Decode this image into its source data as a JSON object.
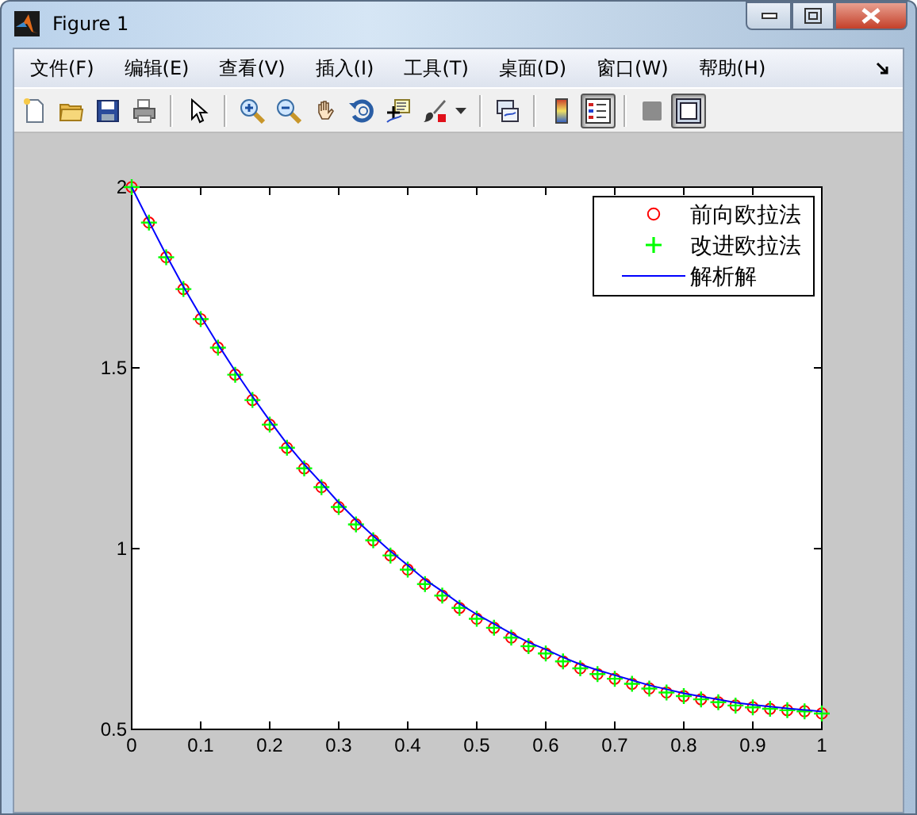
{
  "window": {
    "title": "Figure 1"
  },
  "menu": [
    {
      "label": "文件(F)"
    },
    {
      "label": "编辑(E)"
    },
    {
      "label": "查看(V)"
    },
    {
      "label": "插入(I)"
    },
    {
      "label": "工具(T)"
    },
    {
      "label": "桌面(D)"
    },
    {
      "label": "窗口(W)"
    },
    {
      "label": "帮助(H)"
    }
  ],
  "toolbar": [
    {
      "kind": "new",
      "pressed": false
    },
    {
      "kind": "open",
      "pressed": false
    },
    {
      "kind": "save",
      "pressed": false
    },
    {
      "kind": "print",
      "pressed": false
    },
    {
      "kind": "sep"
    },
    {
      "kind": "pointer",
      "pressed": false
    },
    {
      "kind": "sep"
    },
    {
      "kind": "zoom-in",
      "pressed": false
    },
    {
      "kind": "zoom-out",
      "pressed": false
    },
    {
      "kind": "pan",
      "pressed": false
    },
    {
      "kind": "rotate",
      "pressed": false
    },
    {
      "kind": "data-cursor",
      "pressed": false
    },
    {
      "kind": "brush",
      "pressed": false
    },
    {
      "kind": "caret"
    },
    {
      "kind": "sep"
    },
    {
      "kind": "link",
      "pressed": false
    },
    {
      "kind": "sep"
    },
    {
      "kind": "colorbar",
      "pressed": false
    },
    {
      "kind": "legend",
      "pressed": true
    },
    {
      "kind": "sep"
    },
    {
      "kind": "hide-tools",
      "pressed": false
    },
    {
      "kind": "show-tools",
      "pressed": true
    }
  ],
  "chart_data": {
    "type": "scatter",
    "legend": true,
    "xlim": [
      0,
      1
    ],
    "ylim": [
      0.5,
      2
    ],
    "xticks": [
      0,
      {
        "value": 0.1,
        "label": "0.1"
      },
      {
        "value": 0.2,
        "label": "0.2"
      },
      {
        "value": 0.3,
        "label": "0.3"
      },
      {
        "value": 0.4,
        "label": "0.4"
      },
      {
        "value": 0.5,
        "label": "0.5"
      },
      {
        "value": 0.6,
        "label": "0.6"
      },
      {
        "value": 0.7,
        "label": "0.7"
      },
      {
        "value": 0.8,
        "label": "0.8"
      },
      {
        "value": 0.9,
        "label": "0.9"
      },
      1
    ],
    "yticks": [
      {
        "value": 0.5,
        "label": "0.5"
      },
      1,
      {
        "value": 1.5,
        "label": "1.5"
      },
      2
    ],
    "x": [
      0,
      0.025,
      0.05,
      0.075,
      0.1,
      0.125,
      0.15,
      0.175,
      0.2,
      0.225,
      0.25,
      0.275,
      0.3,
      0.325,
      0.35,
      0.375,
      0.4,
      0.425,
      0.45,
      0.475,
      0.5,
      0.525,
      0.55,
      0.575,
      0.6,
      0.625,
      0.65,
      0.675,
      0.7,
      0.725,
      0.75,
      0.775,
      0.8,
      0.825,
      0.85,
      0.875,
      0.9,
      0.925,
      0.95,
      0.975,
      1
    ],
    "series": [
      {
        "name": "前向欧拉法",
        "marker": "o",
        "color": "#ff0000",
        "values": [
          2,
          1.902,
          1.806,
          1.718,
          1.635,
          1.556,
          1.481,
          1.411,
          1.343,
          1.279,
          1.222,
          1.17,
          1.115,
          1.067,
          1.023,
          0.981,
          0.942,
          0.902,
          0.87,
          0.836,
          0.806,
          0.781,
          0.754,
          0.73,
          0.71,
          0.688,
          0.669,
          0.653,
          0.64,
          0.626,
          0.613,
          0.602,
          0.592,
          0.583,
          0.575,
          0.566,
          0.561,
          0.557,
          0.553,
          0.55,
          0.544
        ]
      },
      {
        "name": "改进欧拉法",
        "marker": "+",
        "color": "#00ff00",
        "values": [
          2,
          1.902,
          1.806,
          1.718,
          1.635,
          1.556,
          1.481,
          1.411,
          1.343,
          1.279,
          1.222,
          1.17,
          1.115,
          1.067,
          1.023,
          0.981,
          0.942,
          0.902,
          0.87,
          0.836,
          0.806,
          0.781,
          0.754,
          0.73,
          0.71,
          0.688,
          0.669,
          0.653,
          0.64,
          0.626,
          0.613,
          0.602,
          0.592,
          0.583,
          0.575,
          0.566,
          0.561,
          0.557,
          0.553,
          0.55,
          0.544
        ]
      },
      {
        "name": "解析解",
        "type": "line",
        "color": "#0000ff",
        "values": [
          2,
          1.905,
          1.812,
          1.725,
          1.643,
          1.565,
          1.491,
          1.421,
          1.354,
          1.29,
          1.233,
          1.181,
          1.127,
          1.079,
          1.035,
          0.993,
          0.954,
          0.914,
          0.882,
          0.848,
          0.818,
          0.792,
          0.765,
          0.741,
          0.721,
          0.699,
          0.68,
          0.664,
          0.65,
          0.636,
          0.622,
          0.611,
          0.6,
          0.591,
          0.583,
          0.574,
          0.568,
          0.563,
          0.558,
          0.554,
          0.549
        ]
      }
    ]
  }
}
